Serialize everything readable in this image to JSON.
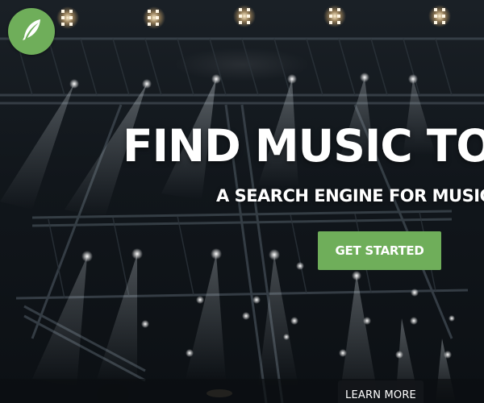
{
  "logo": {
    "icon": "feather-icon",
    "color": "#6fae5a"
  },
  "hero": {
    "headline": "FIND MUSIC TO IN",
    "subheadline": "A SEARCH ENGINE FOR MUSIC LICE",
    "cta_label": "GET STARTED",
    "learn_more_label": "LEARN MORE"
  },
  "colors": {
    "accent": "#6fae5a",
    "text": "#ffffff",
    "background": "#11161b"
  }
}
